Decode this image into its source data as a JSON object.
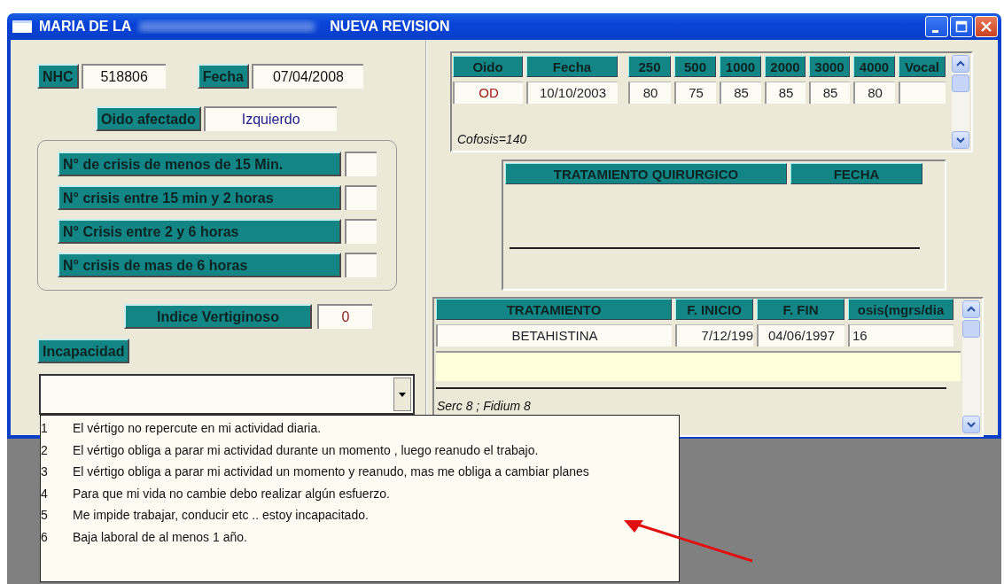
{
  "window": {
    "title_start": "MARIA DE LA",
    "title_end": "NUEVA REVISION"
  },
  "header_fields": [
    {
      "label": "NHC",
      "value": "518806"
    },
    {
      "label": "Fecha",
      "value": "07/04/2008"
    }
  ],
  "oido_afectado": {
    "label": "Oido afectado",
    "value": "Izquierdo"
  },
  "crisis": [
    {
      "label": "N° de crisis de menos de 15 Min."
    },
    {
      "label": "N° crisis entre 15 min y 2 horas"
    },
    {
      "label": "N° Crisis entre 2 y 6 horas"
    },
    {
      "label": "N° crisis de mas de 6 horas"
    }
  ],
  "indice_vertiginoso": {
    "label": "Indice Vertiginoso",
    "value": "0"
  },
  "incapacidad": {
    "label": "Incapacidad",
    "expanded": true,
    "options": [
      {
        "number": "1",
        "text": "El vértigo no repercute en mi actividad diaria."
      },
      {
        "number": "2",
        "text": "El vértigo obliga a parar mi actividad durante un momento , luego reanudo el trabajo."
      },
      {
        "number": "3",
        "text": "El vértigo obliga a parar mi actividad un momento y reanudo, mas me obliga a cambiar planes"
      },
      {
        "number": "4",
        "text": "Para que mi vida no cambie debo realizar algún esfuerzo."
      },
      {
        "number": "5",
        "text": "Me impide trabajar, conducir etc .. estoy incapacitado."
      },
      {
        "number": "6",
        "text": "Baja laboral de al menos 1 año."
      }
    ]
  },
  "audiogram": {
    "columns": [
      "Oido",
      "Fecha",
      "250",
      "500",
      "1000",
      "2000",
      "3000",
      "4000",
      "Vocal"
    ],
    "rows": [
      {
        "cells": [
          "OD",
          "10/10/2003",
          "80",
          "75",
          "85",
          "85",
          "85",
          "80"
        ]
      }
    ],
    "note": "Cofosis=140"
  },
  "surgical": {
    "columns": [
      "TRATAMIENTO QUIRURGICO",
      "FECHA"
    ]
  },
  "treatment": {
    "columns": [
      "TRATAMIENTO",
      "F. INICIO",
      "F. FIN",
      "osis(mgrs/dia"
    ],
    "rows": [
      {
        "cells": [
          "BETAHISTINA",
          "7/12/199",
          "04/06/1997",
          "16"
        ]
      }
    ],
    "note": "Serc 8 ; Fidium 8"
  }
}
